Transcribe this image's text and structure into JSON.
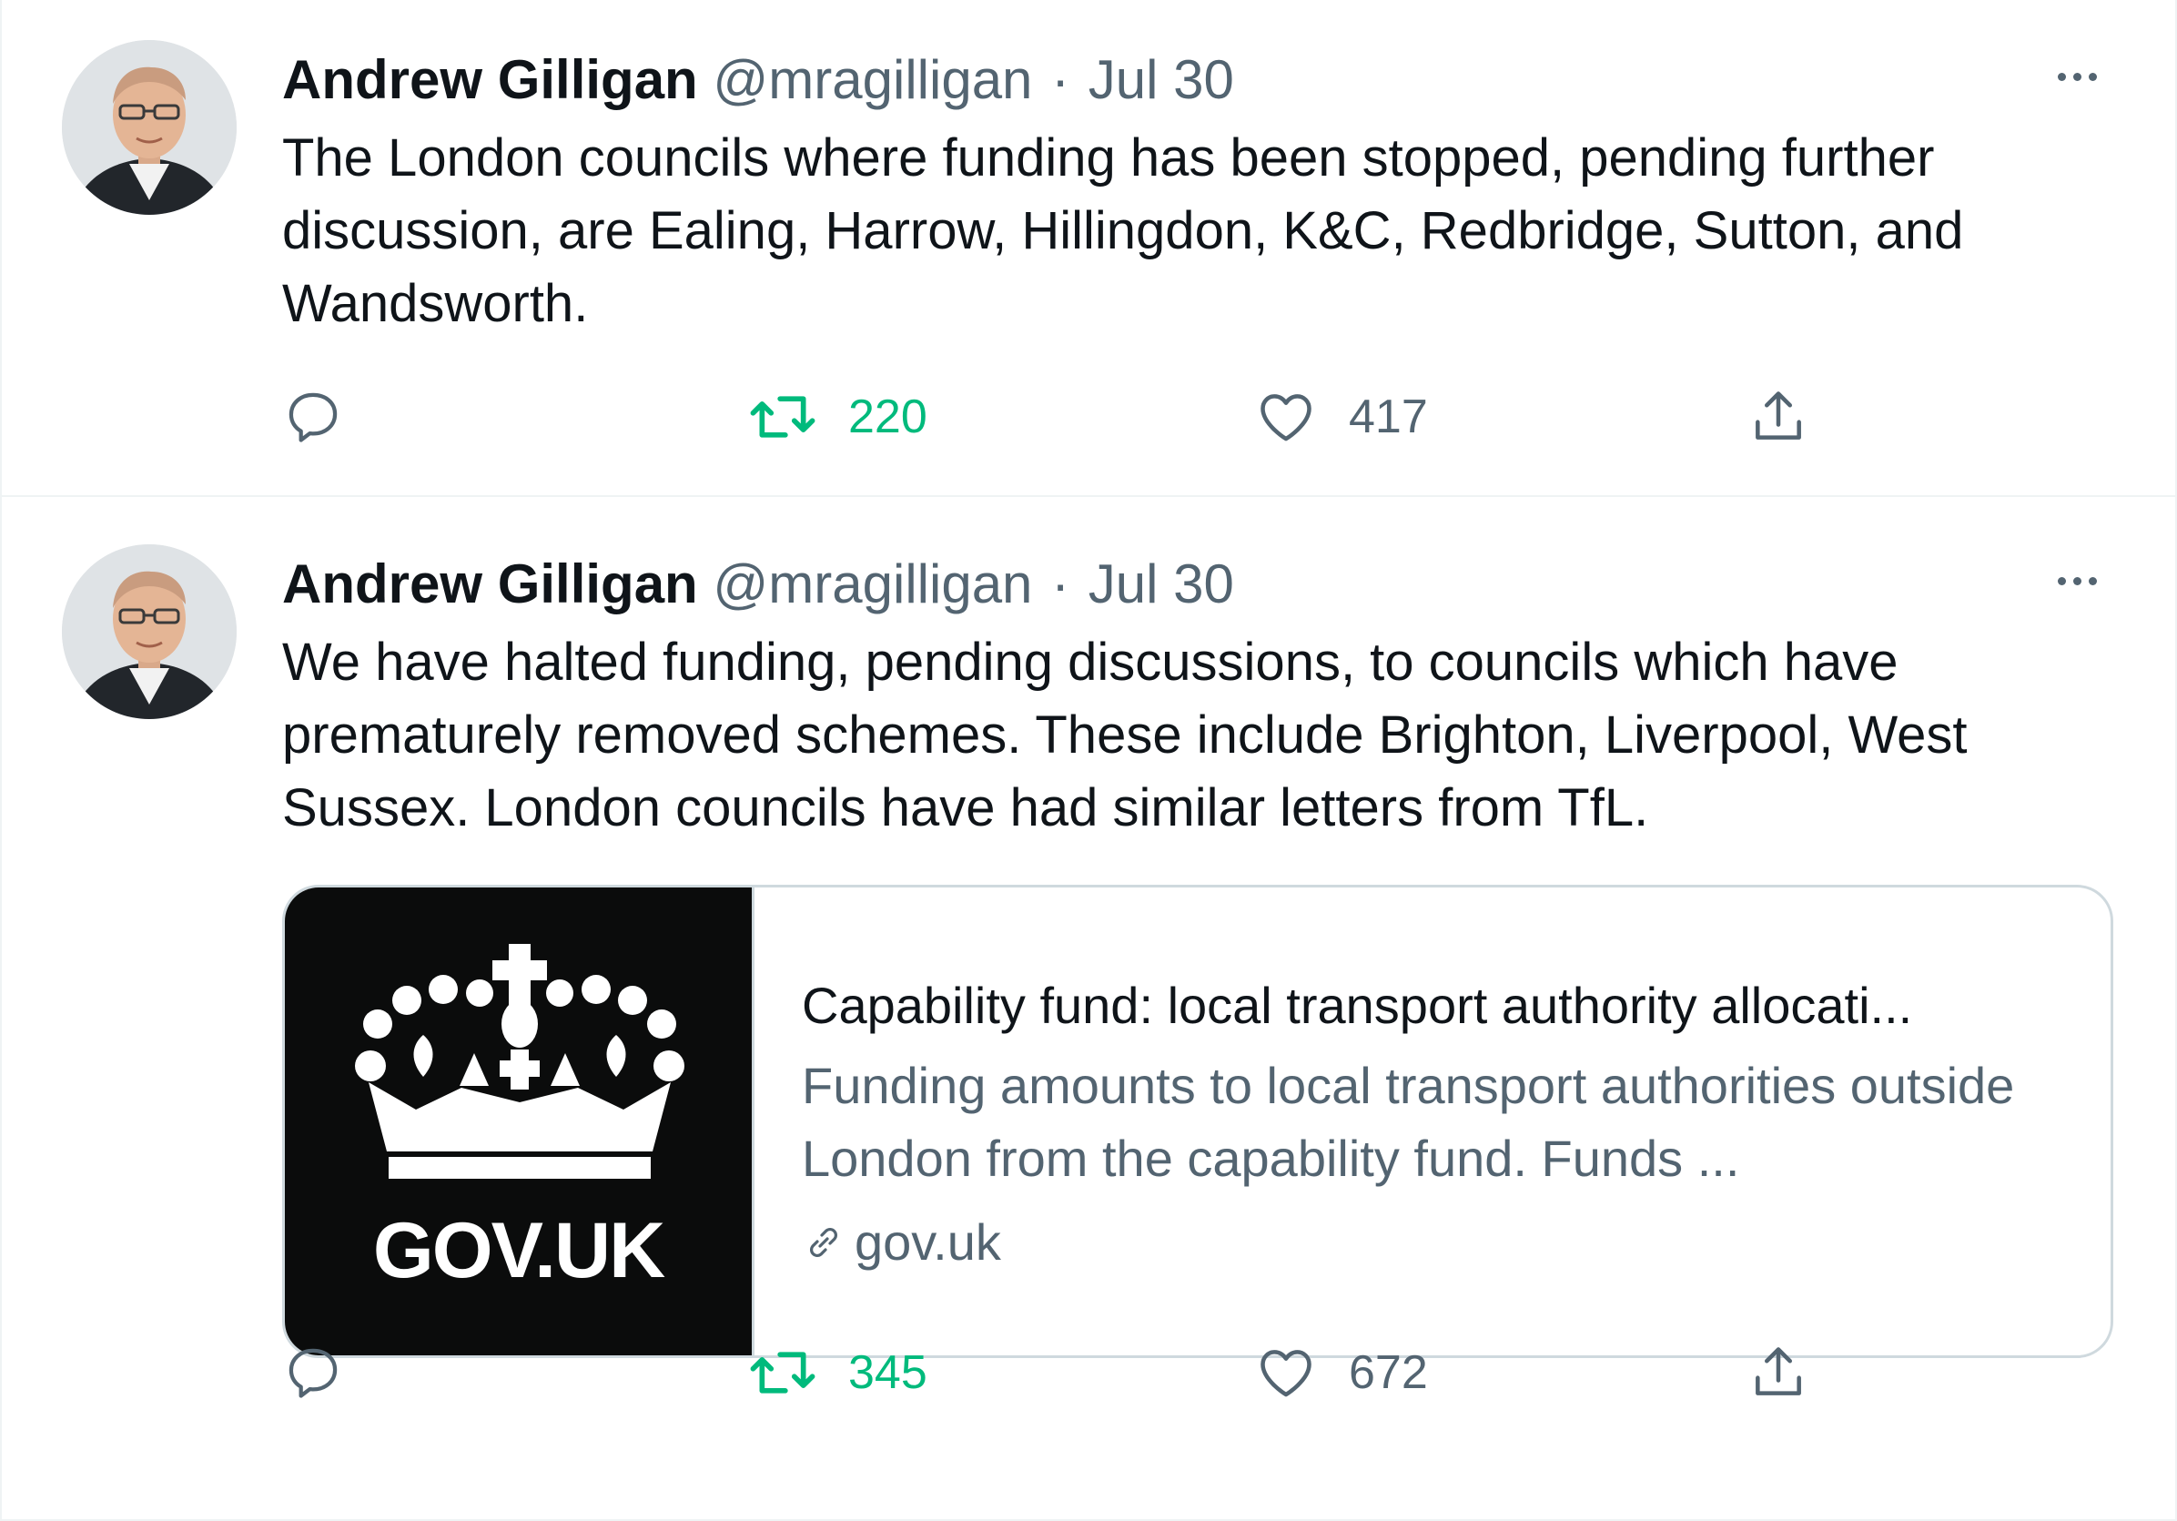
{
  "tweets": [
    {
      "author": {
        "name": "Andrew Gilligan",
        "handle": "@mragilligan"
      },
      "separator": "·",
      "date": "Jul 30",
      "text": "The London councils where funding has been stopped, pending further discussion, are Ealing, Harrow, Hillingdon, K&C, Redbridge, Sutton, and Wandsworth.",
      "stats": {
        "retweets": "220",
        "likes": "417"
      }
    },
    {
      "author": {
        "name": "Andrew Gilligan",
        "handle": "@mragilligan"
      },
      "separator": "·",
      "date": "Jul 30",
      "text": "We have halted funding, pending discussions, to councils which have prematurely removed schemes. These include Brighton, Liverpool, West Sussex. London councils have had similar letters from TfL.",
      "card": {
        "image_logo_text": "GOV.UK",
        "title": "Capability fund: local transport authority allocati...",
        "description": "Funding amounts to local transport authorities outside London from the capability fund. Funds ...",
        "domain": "gov.uk"
      },
      "stats": {
        "retweets": "345",
        "likes": "672"
      }
    }
  ],
  "icons": {
    "avatar": "profile-photo",
    "more": "more-horizontal-icon",
    "reply": "reply-bubble-icon",
    "retweet": "retweet-icon",
    "like": "heart-icon",
    "share": "share-upload-icon",
    "link": "link-icon",
    "card_image": "crown-logo"
  },
  "colors": {
    "text_primary": "#0f1419",
    "text_secondary": "#536471",
    "retweet_active": "#00ba7c",
    "border": "#cfd9de",
    "divider": "#eff3f4",
    "govuk_black": "#0b0c0c"
  }
}
